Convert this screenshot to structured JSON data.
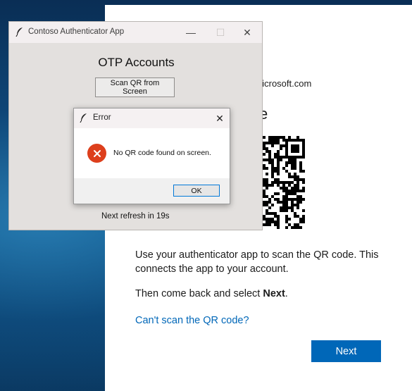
{
  "signin": {
    "email_partial": "nicrosoft.com",
    "heading_partial": "e",
    "instructions": "Use your authenticator app to scan the QR code. This connects the app to your account.",
    "then_prefix": "Then come back and select ",
    "then_bold": "Next",
    "then_suffix": ".",
    "cant_scan_link": "Can't scan the QR code?",
    "next_button": "Next",
    "accent_color": "#0067b8"
  },
  "auth_window": {
    "title": "Contoso Authenticator App",
    "heading": "OTP Accounts",
    "scan_button": "Scan QR from Screen",
    "refresh_text": "Next refresh in 19s",
    "controls": {
      "minimize": "—",
      "maximize": "☐",
      "close": "✕"
    }
  },
  "error_dialog": {
    "title": "Error",
    "message": "No QR code found on screen.",
    "ok_button": "OK",
    "close": "✕",
    "icon": "error-icon",
    "icon_color": "#dd3f1c"
  }
}
